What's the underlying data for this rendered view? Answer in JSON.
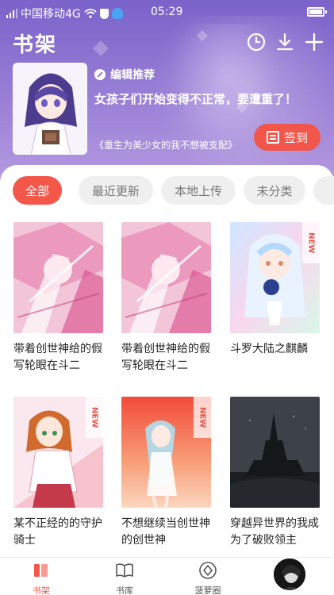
{
  "status_bar": {
    "carrier": "中国移动4G",
    "time": "05:29"
  },
  "header": {
    "title": "书架"
  },
  "recommendation": {
    "badge": "编辑推荐",
    "headline": "女孩子们开始变得不正常，要遭重了！",
    "book_title": "《重生为美少女的我不想被支配》",
    "checkin_label": "签到"
  },
  "tabs": [
    {
      "label": "全部",
      "active": true
    },
    {
      "label": "最近更新",
      "active": false
    },
    {
      "label": "本地上传",
      "active": false
    },
    {
      "label": "未分类",
      "active": false
    }
  ],
  "books": [
    {
      "title": "带着创世神给的假写轮眼在斗二",
      "new": false
    },
    {
      "title": "带着创世神给的假写轮眼在斗二",
      "new": false
    },
    {
      "title": "斗罗大陆之麒麟",
      "new": true
    },
    {
      "title": "某不正经的的守护骑士",
      "new": true
    },
    {
      "title": "不想继续当创世神的创世神",
      "new": true
    },
    {
      "title": "穿越异世界的我成为了破败领主",
      "new": false
    }
  ],
  "new_tag_label": "NEW",
  "bottom_nav": [
    {
      "label": "书架",
      "icon": "bookshelf-icon",
      "active": true
    },
    {
      "label": "书库",
      "icon": "open-book-icon",
      "active": false
    },
    {
      "label": "菠萝圈",
      "icon": "pineapple-circle-icon",
      "active": false
    }
  ],
  "colors": {
    "accent": "#f3574a",
    "header_top": "#7a63c9",
    "header_bottom": "#b39ae0"
  }
}
